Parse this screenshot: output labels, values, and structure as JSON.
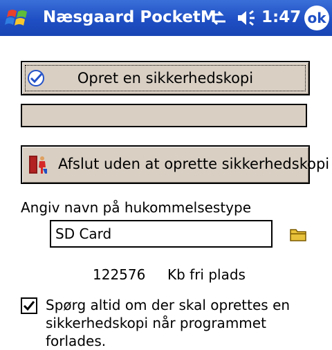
{
  "titlebar": {
    "title": "Næsgaard PocketM",
    "time": "1:47",
    "ok_label": "ok",
    "icons": [
      "windows-start-icon",
      "connectivity-icon",
      "speaker-icon"
    ]
  },
  "backup_button": {
    "label": "Opret en sikkerhedskopi",
    "icon": "checkmark-circle-icon"
  },
  "progress": {
    "value": 0
  },
  "exit_button": {
    "label": "Afslut uden at oprette sikkerhedskopi",
    "icon": "exit-door-icon"
  },
  "memory": {
    "label": "Angiv navn på hukommelsestype",
    "value": "SD Card",
    "free_kb": "122576",
    "free_text": "Kb fri plads"
  },
  "ask_checkbox": {
    "checked": true,
    "label": "Spørg altid om der skal oprettes en sikkerhedskopi når programmet forlades."
  },
  "colors": {
    "titlebar": "#1f4fc4",
    "button_face": "#d9cfc3"
  }
}
